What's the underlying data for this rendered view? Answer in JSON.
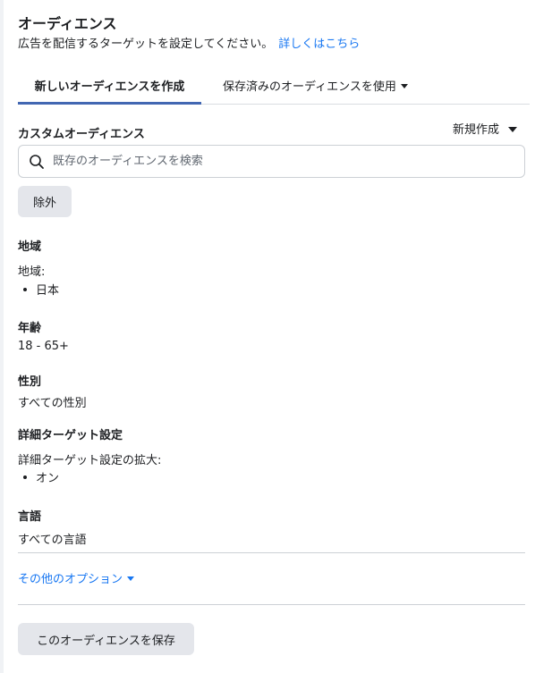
{
  "header": {
    "title": "オーディエンス",
    "subtitle": "広告を配信するターゲットを設定してください。",
    "link": "詳しくはこちら"
  },
  "tabs": {
    "active": "新しいオーディエンスを作成",
    "saved": "保存済みのオーディエンスを使用"
  },
  "custom_audience": {
    "label": "カスタムオーディエンス",
    "new_create": "新規作成",
    "search_placeholder": "既存のオーディエンスを検索",
    "exclude": "除外"
  },
  "location": {
    "label": "地域",
    "sublabel": "地域:",
    "items": [
      "日本"
    ]
  },
  "age": {
    "label": "年齢",
    "value": "18 - 65+"
  },
  "gender": {
    "label": "性別",
    "value": "すべての性別"
  },
  "detailed_targeting": {
    "label": "詳細ターゲット設定",
    "sublabel": "詳細ターゲット設定の拡大:",
    "items": [
      "オン"
    ]
  },
  "language": {
    "label": "言語",
    "value": "すべての言語"
  },
  "more_options": "その他のオプション",
  "save_button": "このオーディエンスを保存",
  "colors": {
    "accent": "#4267b2",
    "link": "#1877f2",
    "button_bg": "#e4e6eb"
  }
}
